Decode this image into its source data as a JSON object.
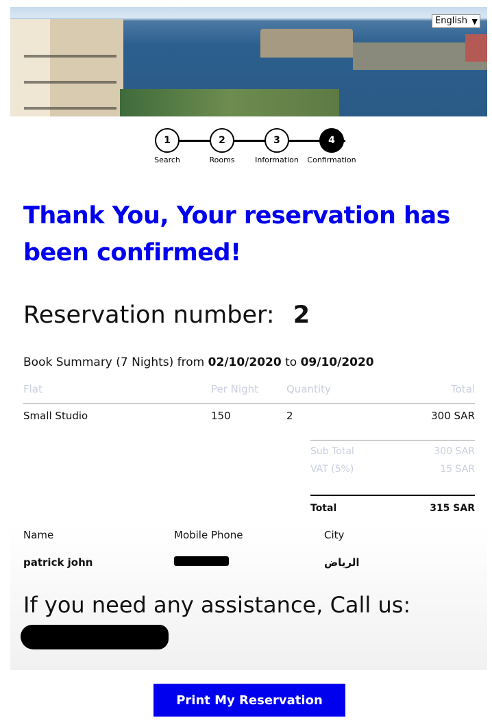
{
  "header": {
    "language": "English",
    "language_icon": "chevron-down-icon"
  },
  "steps": [
    {
      "number": "1",
      "label": "Search"
    },
    {
      "number": "2",
      "label": "Rooms"
    },
    {
      "number": "3",
      "label": "Information"
    },
    {
      "number": "4",
      "label": "Confirmation",
      "active": true
    }
  ],
  "confirmation": {
    "title": "Thank You, Your reservation has been confirmed!",
    "reservation_label": "Reservation number:",
    "reservation_number": "2"
  },
  "summary": {
    "prefix": "Book Summary (7 Nights) from",
    "from_date": "02/10/2020",
    "to_word": "to",
    "to_date": "09/10/2020"
  },
  "table": {
    "columns": [
      "Flat",
      "Per Night",
      "Quantity",
      "Total"
    ],
    "rows": [
      {
        "flat": "Small Studio",
        "per_night": "150",
        "quantity": "2",
        "total": "300 SAR"
      }
    ]
  },
  "totals": {
    "subtotal_label": "Sub Total",
    "subtotal_value": "300 SAR",
    "vat_label": "VAT (5%)",
    "vat_value": "15 SAR",
    "total_label": "Total",
    "total_value": "315 SAR"
  },
  "guest": {
    "name_label": "Name",
    "name_value": "patrick john",
    "phone_label": "Mobile Phone",
    "city_label": "City",
    "city_value": "الرياض"
  },
  "help": {
    "text": "If you need any assistance, Call us:"
  },
  "actions": {
    "print_label": "Print My Reservation"
  },
  "colors": {
    "accent": "#0000ee"
  }
}
